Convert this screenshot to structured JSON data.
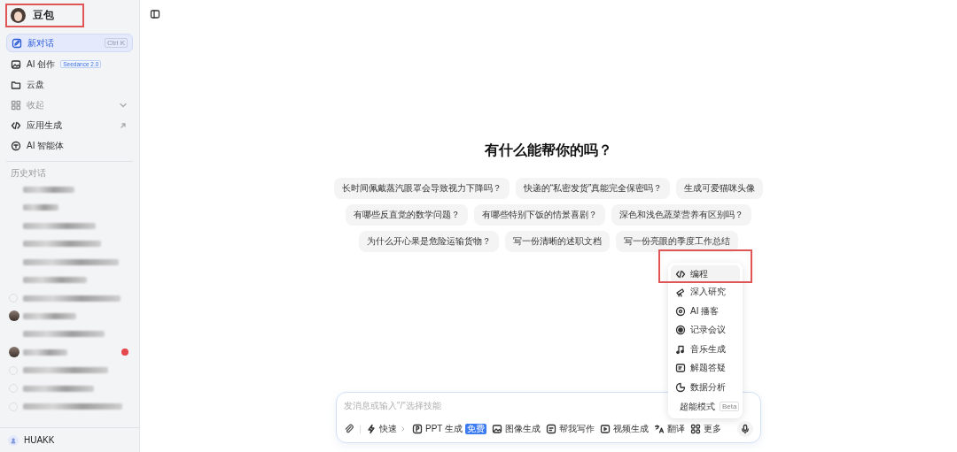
{
  "sidebar": {
    "brand": {
      "name": "豆包",
      "highlighted": true
    },
    "nav": [
      {
        "kind": "new",
        "label": "新对话",
        "shortcut": "Ctrl K",
        "selected": true
      },
      {
        "kind": "item",
        "label": "AI 创作",
        "badge": "Seedance 2.0",
        "selected": false
      },
      {
        "kind": "item",
        "label": "云盘",
        "selected": false
      },
      {
        "kind": "collapse",
        "label": "收起",
        "selected": false
      },
      {
        "kind": "external",
        "label": "应用生成",
        "selected": false
      },
      {
        "kind": "item",
        "label": "AI 智能体",
        "selected": false
      }
    ],
    "history": {
      "heading": "历史对话",
      "items": [
        {
          "kind": "plain",
          "unread": false
        },
        {
          "kind": "plain",
          "unread": false
        },
        {
          "kind": "plain",
          "unread": false
        },
        {
          "kind": "plain",
          "unread": false
        },
        {
          "kind": "plain",
          "unread": false
        },
        {
          "kind": "plain",
          "unread": false
        },
        {
          "kind": "chat",
          "unread": false
        },
        {
          "kind": "avatar",
          "unread": false
        },
        {
          "kind": "plain",
          "unread": false
        },
        {
          "kind": "avatar",
          "unread": true
        },
        {
          "kind": "chat",
          "unread": false
        },
        {
          "kind": "chat",
          "unread": false
        },
        {
          "kind": "chat",
          "unread": false
        }
      ]
    },
    "user": {
      "name": "HUAKK"
    }
  },
  "main": {
    "title": "有什么能帮你的吗？",
    "suggestion_rows": [
      {
        "chips": [
          "长时间佩戴蒸汽眼罩会导致视力下降吗？",
          "快递的“私密发货”真能完全保密吗？",
          "生成可爱猫咪头像"
        ]
      },
      {
        "chips": [
          "有哪些反直觉的数学问题？",
          "有哪些特别下饭的情景喜剧？",
          "深色和浅色蔬菜营养有区别吗？"
        ]
      },
      {
        "chips": [
          "为什么开心果是危险运输货物？",
          "写一份清晰的述职文档",
          "写一份亮眼的季度工作总结"
        ]
      }
    ],
    "skills_menu": {
      "items": [
        {
          "label": "编程",
          "selected": true,
          "highlighted": true
        },
        {
          "label": "深入研究",
          "selected": false,
          "highlighted": false
        },
        {
          "label": "AI 播客",
          "selected": false,
          "highlighted": false
        },
        {
          "label": "记录会议",
          "selected": false,
          "highlighted": false
        },
        {
          "label": "音乐生成",
          "selected": false,
          "highlighted": false
        },
        {
          "label": "解题答疑",
          "selected": false,
          "highlighted": false
        },
        {
          "label": "数据分析",
          "selected": false,
          "highlighted": false
        },
        {
          "label": "超能模式",
          "badge": "Beta",
          "selected": false,
          "highlighted": false
        }
      ]
    },
    "composer": {
      "placeholder": "发消息或输入\"/\"选择技能",
      "tools": [
        {
          "kind": "mode",
          "label": "快速"
        },
        {
          "kind": "tool",
          "label": "PPT 生成",
          "badge": "免费"
        },
        {
          "kind": "tool",
          "label": "图像生成"
        },
        {
          "kind": "tool",
          "label": "帮我写作"
        },
        {
          "kind": "tool",
          "label": "视频生成"
        },
        {
          "kind": "tool",
          "label": "翻译"
        },
        {
          "kind": "tool",
          "label": "更多"
        }
      ]
    }
  }
}
